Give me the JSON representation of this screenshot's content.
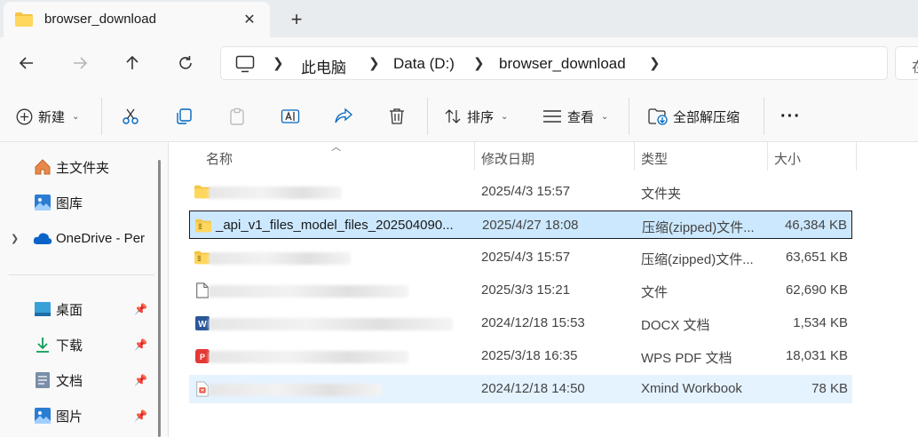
{
  "tab": {
    "title": "browser_download",
    "close_icon": "close-icon",
    "new_tab_icon": "plus-icon"
  },
  "nav": {
    "back": "arrow-left-icon",
    "forward": "arrow-right-icon",
    "up": "arrow-up-icon",
    "refresh": "refresh-icon"
  },
  "breadcrumb": {
    "items": [
      "此电脑",
      "Data (D:)",
      "browser_download"
    ]
  },
  "search": {
    "placeholder": "在"
  },
  "toolbar": {
    "new_label": "新建",
    "sort_label": "排序",
    "view_label": "查看",
    "extract_label": "全部解压缩",
    "more_label": "···"
  },
  "sidebar": {
    "items": [
      {
        "label": "主文件夹",
        "icon": "home-icon"
      },
      {
        "label": "图库",
        "icon": "gallery-icon"
      },
      {
        "label": "OneDrive - Per",
        "icon": "cloud-icon"
      },
      {
        "label": "桌面",
        "icon": "desktop-icon"
      },
      {
        "label": "下载",
        "icon": "download-icon"
      },
      {
        "label": "文档",
        "icon": "document-icon"
      },
      {
        "label": "图片",
        "icon": "picture-icon"
      }
    ]
  },
  "columns": {
    "name": "名称",
    "date": "修改日期",
    "type": "类型",
    "size": "大小"
  },
  "files": [
    {
      "name": "",
      "date": "2025/4/3 15:57",
      "type": "文件夹",
      "size": "",
      "icon": "folder-icon"
    },
    {
      "name": "_api_v1_files_model_files_202504090...",
      "date": "2025/4/27 18:08",
      "type": "压缩(zipped)文件...",
      "size": "46,384 KB",
      "icon": "zip-folder-icon"
    },
    {
      "name": "",
      "date": "2025/4/3 15:57",
      "type": "压缩(zipped)文件...",
      "size": "63,651 KB",
      "icon": "zip-folder-icon"
    },
    {
      "name": "",
      "date": "2025/3/3 15:21",
      "type": "文件",
      "size": "62,690 KB",
      "icon": "file-icon"
    },
    {
      "name": "",
      "date": "2024/12/18 15:53",
      "type": "DOCX 文档",
      "size": "1,534 KB",
      "icon": "word-icon"
    },
    {
      "name": "",
      "date": "2025/3/18 16:35",
      "type": "WPS PDF 文档",
      "size": "18,031 KB",
      "icon": "pdf-icon"
    },
    {
      "name": "",
      "date": "2024/12/18 14:50",
      "type": "Xmind Workbook",
      "size": "78 KB",
      "icon": "xmind-icon"
    }
  ],
  "colors": {
    "accent": "#0067c0",
    "selection": "#cce8ff",
    "hover": "#e5f3ff",
    "folder": "#f4c542"
  }
}
